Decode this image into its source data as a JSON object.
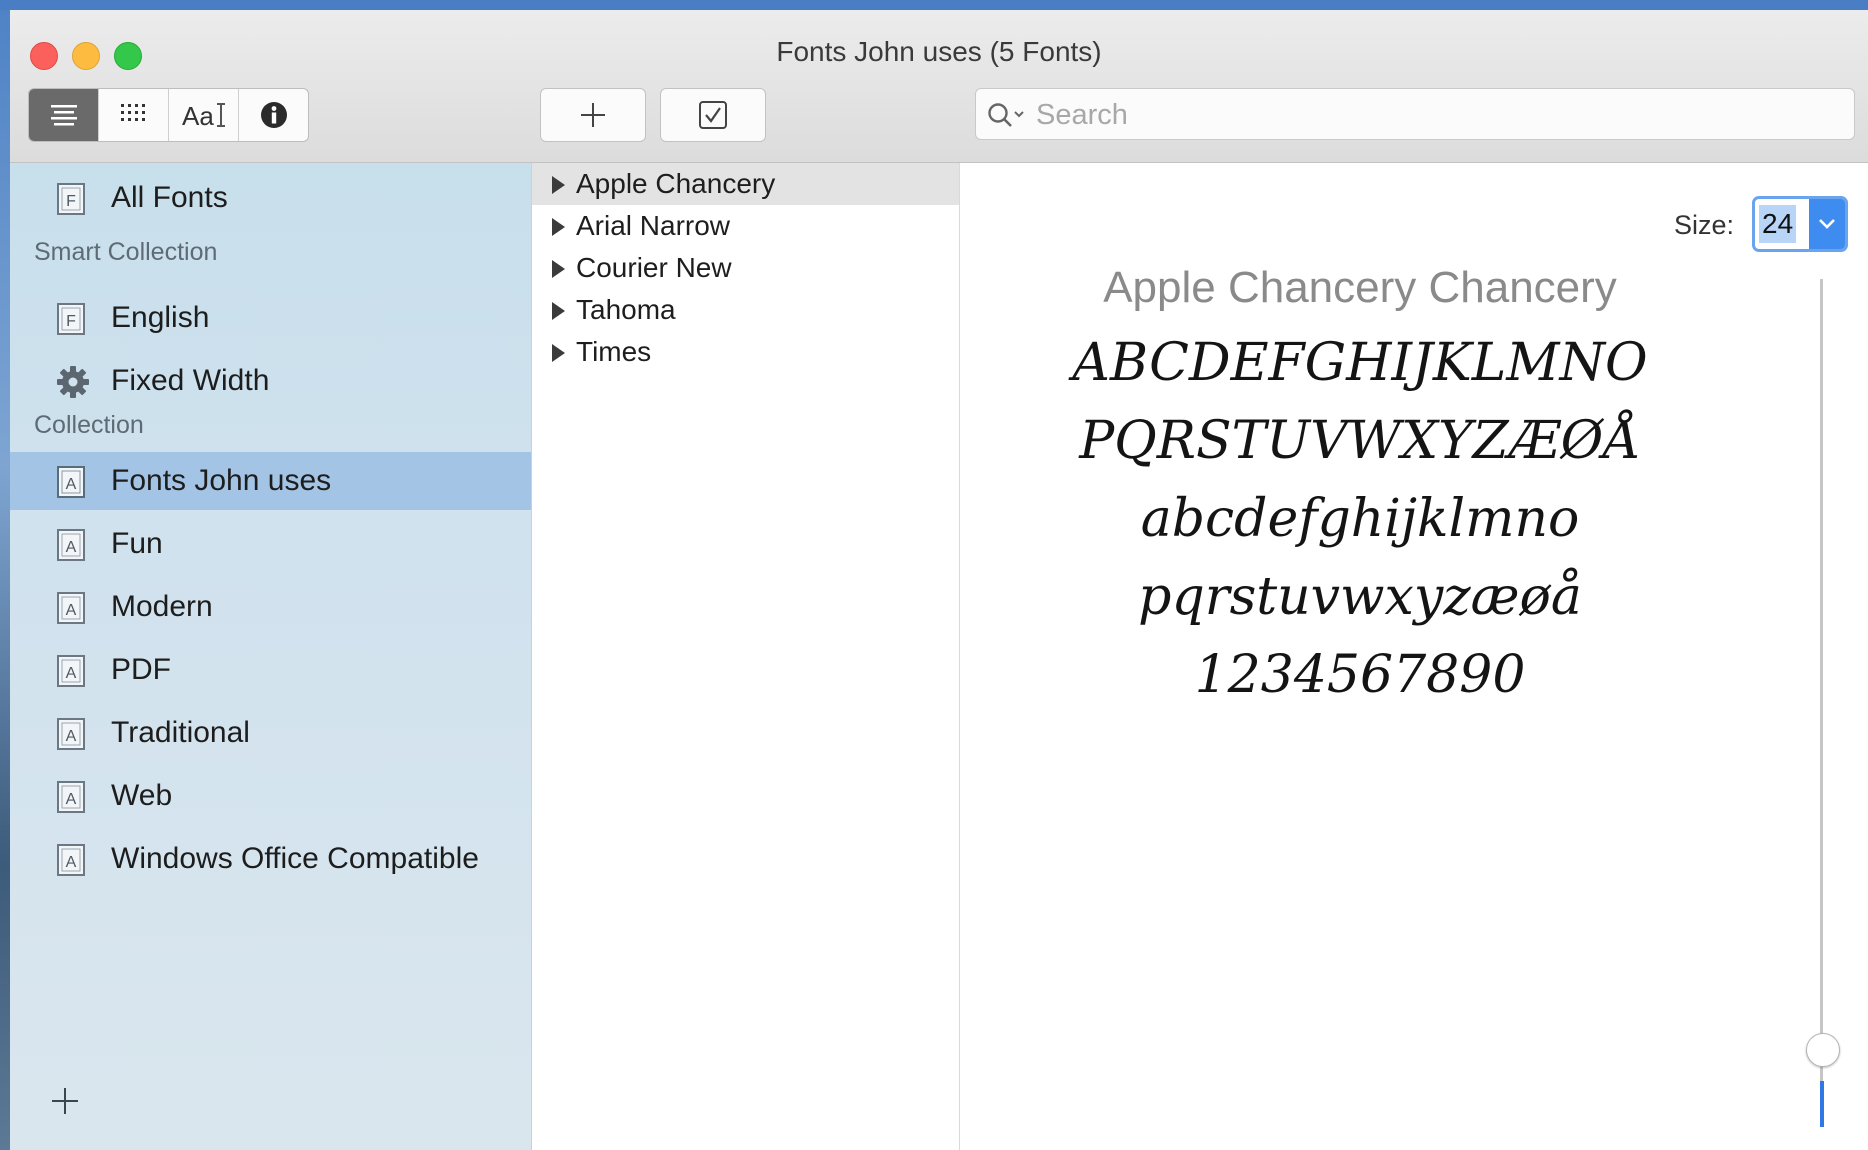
{
  "window": {
    "title": "Fonts John uses (5 Fonts)"
  },
  "toolbar": {
    "view_buttons": [
      {
        "name": "list-view",
        "icon": "list-icon",
        "active": true
      },
      {
        "name": "grid-view",
        "icon": "grid-icon",
        "active": false
      },
      {
        "name": "sample-view",
        "icon": "sample-text-icon",
        "label": "Aa",
        "active": false
      },
      {
        "name": "info-view",
        "icon": "info-icon",
        "active": false
      }
    ],
    "add_icon": "plus-icon",
    "validate_icon": "checkbox-icon",
    "search": {
      "placeholder": "Search",
      "value": ""
    }
  },
  "sidebar": {
    "all_fonts": {
      "label": "All Fonts",
      "icon": "font-file-icon"
    },
    "smart_heading": "Smart Collection",
    "smart_items": [
      {
        "label": "English",
        "icon": "font-file-icon"
      },
      {
        "label": "Fixed Width",
        "icon": "gear-icon"
      }
    ],
    "collection_heading": "Collection",
    "collections": [
      {
        "label": "Fonts John uses",
        "selected": true
      },
      {
        "label": "Fun",
        "selected": false
      },
      {
        "label": "Modern",
        "selected": false
      },
      {
        "label": "PDF",
        "selected": false
      },
      {
        "label": "Traditional",
        "selected": false
      },
      {
        "label": "Web",
        "selected": false
      },
      {
        "label": "Windows Office Compatible",
        "selected": false
      }
    ],
    "add_icon": "plus-icon"
  },
  "font_list": [
    {
      "name": "Apple Chancery",
      "selected": true
    },
    {
      "name": "Arial Narrow",
      "selected": false
    },
    {
      "name": "Courier New",
      "selected": false
    },
    {
      "name": "Tahoma",
      "selected": false
    },
    {
      "name": "Times",
      "selected": false
    }
  ],
  "preview": {
    "size_label": "Size:",
    "size_value": "24",
    "font_title": "Apple Chancery Chancery",
    "lines": [
      "ABCDEFGHIJKLMNO",
      "PQRSTUVWXYZÆØÅ",
      "abcdefghijklmno",
      "pqrstuvwxyzæøå",
      "1234567890"
    ],
    "size_fraction": 0.06
  },
  "colors": {
    "selection_sidebar": "#a3c4e4",
    "accent": "#3e8cf0",
    "sidebar_bg": "#cfe1ed"
  }
}
